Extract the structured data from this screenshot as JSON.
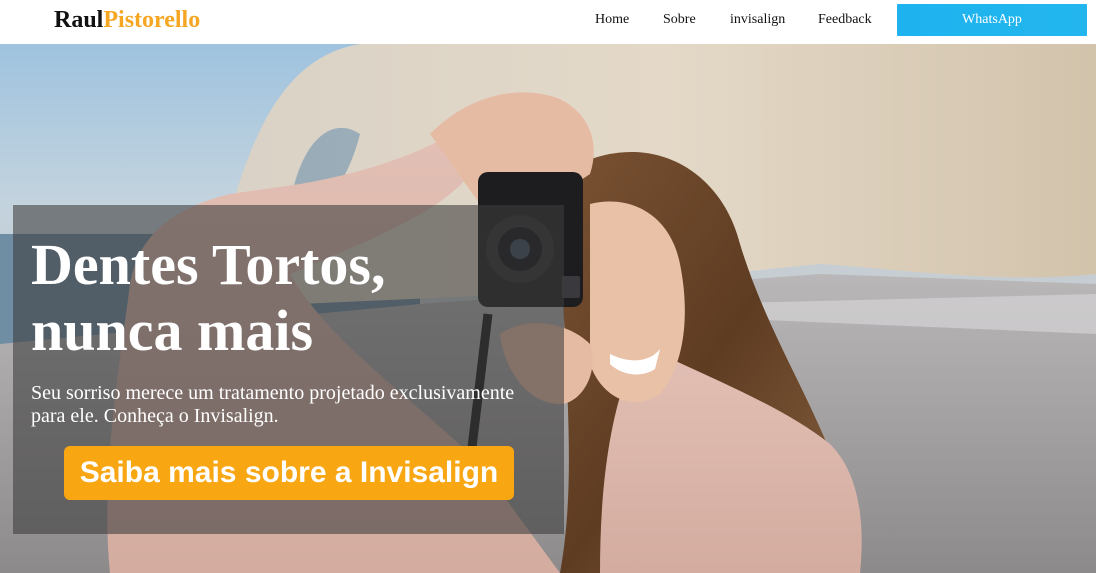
{
  "header": {
    "logo_first": "Raul",
    "logo_last": "Pistorello",
    "nav": {
      "home": "Home",
      "sobre": "Sobre",
      "invisalign": "invisalign",
      "feedback": "Feedback"
    },
    "whatsapp_label": "WhatsApp"
  },
  "hero": {
    "headline": "Dentes Tortos, nunca mais",
    "subtext": "Seu sorriso merece um tratamento projetado exclusivamente para ele. Conheça o Invisalign.",
    "cta_label": "Saiba mais sobre a Invisalign"
  },
  "colors": {
    "logo_accent": "#f5a623",
    "whatsapp_button": "#1eb3ef",
    "cta_button": "#f8a612",
    "overlay": "rgba(60,60,60,0.58)"
  }
}
